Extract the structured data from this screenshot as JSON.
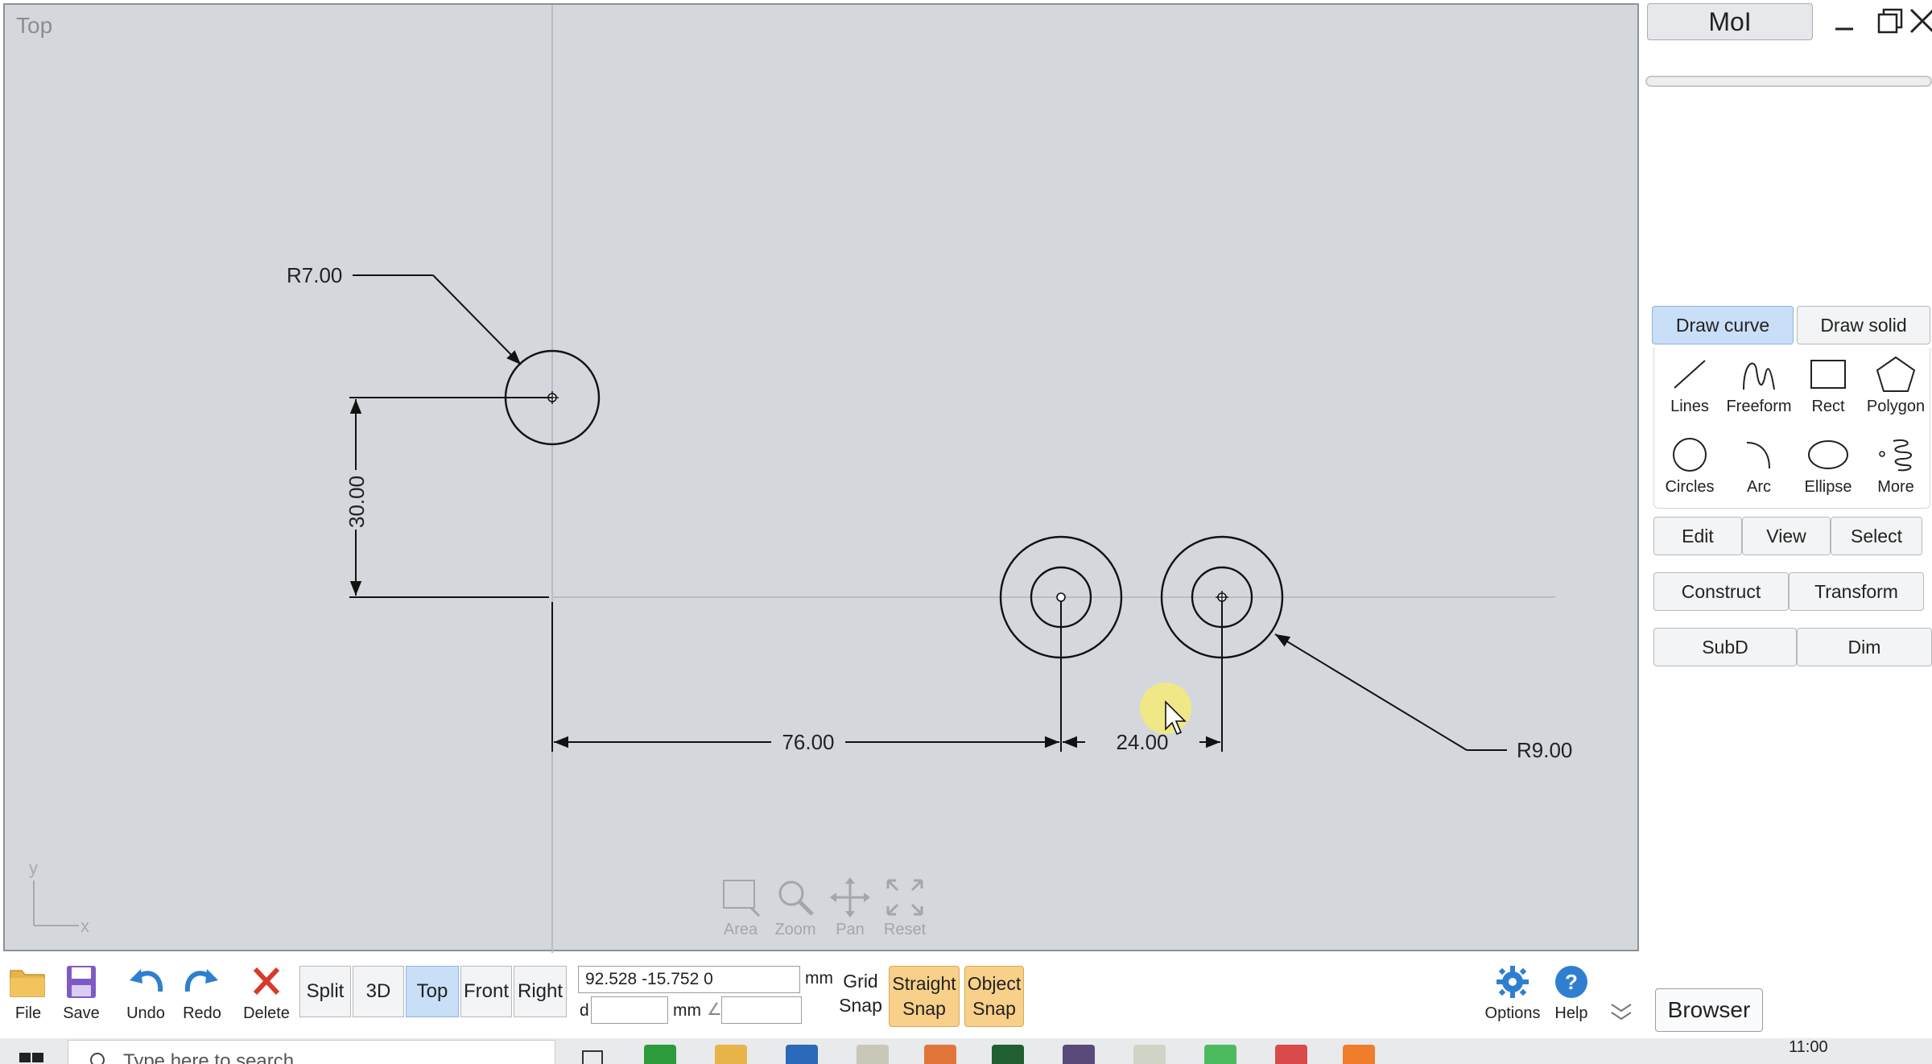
{
  "viewport": {
    "label": "Top",
    "dimensions": {
      "radius_small": "R7.00",
      "vertical": "30.00",
      "horizontal_long": "76.00",
      "horizontal_short": "24.00",
      "radius_large": "R9.00"
    },
    "axis_y": "y",
    "axis_x": "x",
    "nav": [
      {
        "label": "Area",
        "icon": "zoom-area-icon"
      },
      {
        "label": "Zoom",
        "icon": "magnifier-icon"
      },
      {
        "label": "Pan",
        "icon": "pan-arrows-icon"
      },
      {
        "label": "Reset",
        "icon": "reset-view-icon"
      }
    ]
  },
  "window": {
    "title": "MoI",
    "controls": [
      "minimize-icon",
      "restore-icon",
      "close-icon"
    ]
  },
  "panel": {
    "tabs": [
      {
        "label": "Draw curve",
        "active": true
      },
      {
        "label": "Draw solid",
        "active": false
      }
    ],
    "tools": [
      {
        "label": "Lines",
        "icon": "line-icon"
      },
      {
        "label": "Freeform",
        "icon": "freeform-curve-icon"
      },
      {
        "label": "Rect",
        "icon": "rectangle-icon"
      },
      {
        "label": "Polygon",
        "icon": "polygon-icon"
      },
      {
        "label": "Circles",
        "icon": "circle-icon"
      },
      {
        "label": "Arc",
        "icon": "arc-icon"
      },
      {
        "label": "Ellipse",
        "icon": "ellipse-icon"
      },
      {
        "label": "More",
        "icon": "spiral-icon"
      }
    ],
    "row1": [
      "Edit",
      "View",
      "Select"
    ],
    "row2": [
      "Construct",
      "Transform"
    ],
    "row3": [
      "SubD",
      "Dim"
    ]
  },
  "toolbar": {
    "file": "File",
    "save": "Save",
    "undo": "Undo",
    "redo": "Redo",
    "delete": "Delete",
    "views": [
      {
        "label": "Split",
        "active": false
      },
      {
        "label": "3D",
        "active": false
      },
      {
        "label": "Top",
        "active": true
      },
      {
        "label": "Front",
        "active": false
      },
      {
        "label": "Right",
        "active": false
      }
    ],
    "coords": "92.528   -15.752   0",
    "unit": "mm",
    "distance_label": "d",
    "distance_unit": "mm",
    "angle_symbol": "∠",
    "grid_snap_line1": "Grid",
    "grid_snap_line2": "Snap",
    "straight_snap_line1": "Straight",
    "straight_snap_line2": "Snap",
    "object_snap_line1": "Object",
    "object_snap_line2": "Snap",
    "options": "Options",
    "help": "Help",
    "browser": "Browser"
  },
  "taskbar": {
    "search_placeholder": "Type here to search",
    "clock": "11:00"
  },
  "colors": {
    "viewport_bg": "#d4d7dc",
    "active_tab": "#c9def7",
    "snap_on": "#f8d08a",
    "icon_blue": "#2f7fd0",
    "delete_red": "#d63a2a",
    "cursor_highlight": "#f3ea7c"
  }
}
